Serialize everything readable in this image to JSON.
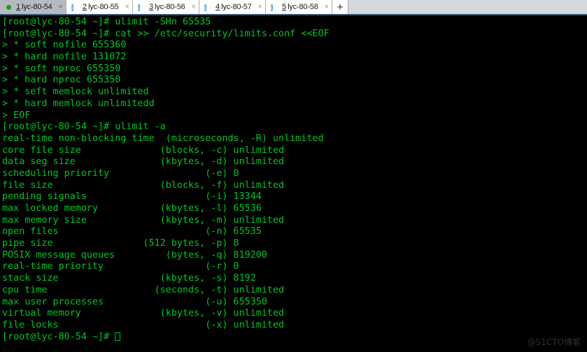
{
  "tabbar": {
    "new_tab_label": "+",
    "close_label": "×",
    "tabs": [
      {
        "index": "1",
        "title": "lyc-80-54",
        "status_icon": "green-dot-icon",
        "active": true
      },
      {
        "index": "2",
        "title": "lyc-80-55",
        "status_icon": "info-icon",
        "active": false
      },
      {
        "index": "3",
        "title": "lyc-80-56",
        "status_icon": "info-icon",
        "active": false
      },
      {
        "index": "4",
        "title": "lyc-80-57",
        "status_icon": "info-icon",
        "active": false
      },
      {
        "index": "5",
        "title": "lyc-80-58",
        "status_icon": "info-icon",
        "active": false
      }
    ]
  },
  "terminal": {
    "foreground_color": "#00c425",
    "background_color": "#000000",
    "prompt": "[root@lyc-80-54 ~]#",
    "lines": [
      "[root@lyc-80-54 ~]# ulimit -SHn 65535",
      "[root@lyc-80-54 ~]# cat >> /etc/security/limits.conf <<EOF",
      "> * soft nofile 655360",
      "> * hard nofile 131072",
      "> * soft nproc 655350",
      "> * hard nproc 655350",
      "> * seft memlock unlimited",
      "> * hard memlock unlimitedd",
      "> EOF",
      "[root@lyc-80-54 ~]# ulimit -a",
      "real-time non-blocking time  (microseconds, -R) unlimited",
      "core file size              (blocks, -c) unlimited",
      "data seg size               (kbytes, -d) unlimited",
      "scheduling priority                 (-e) 0",
      "file size                   (blocks, -f) unlimited",
      "pending signals                     (-i) 13344",
      "max locked memory           (kbytes, -l) 65536",
      "max memory size             (kbytes, -m) unlimited",
      "open files                          (-n) 65535",
      "pipe size                (512 bytes, -p) 8",
      "POSIX message queues         (bytes, -q) 819200",
      "real-time priority                  (-r) 0",
      "stack size                  (kbytes, -s) 8192",
      "cpu time                   (seconds, -t) unlimited",
      "max user processes                  (-u) 655350",
      "virtual memory              (kbytes, -v) unlimited",
      "file locks                          (-x) unlimited"
    ],
    "last_line": "[root@lyc-80-54 ~]# "
  },
  "watermark": {
    "text": "@51CTO博客"
  }
}
